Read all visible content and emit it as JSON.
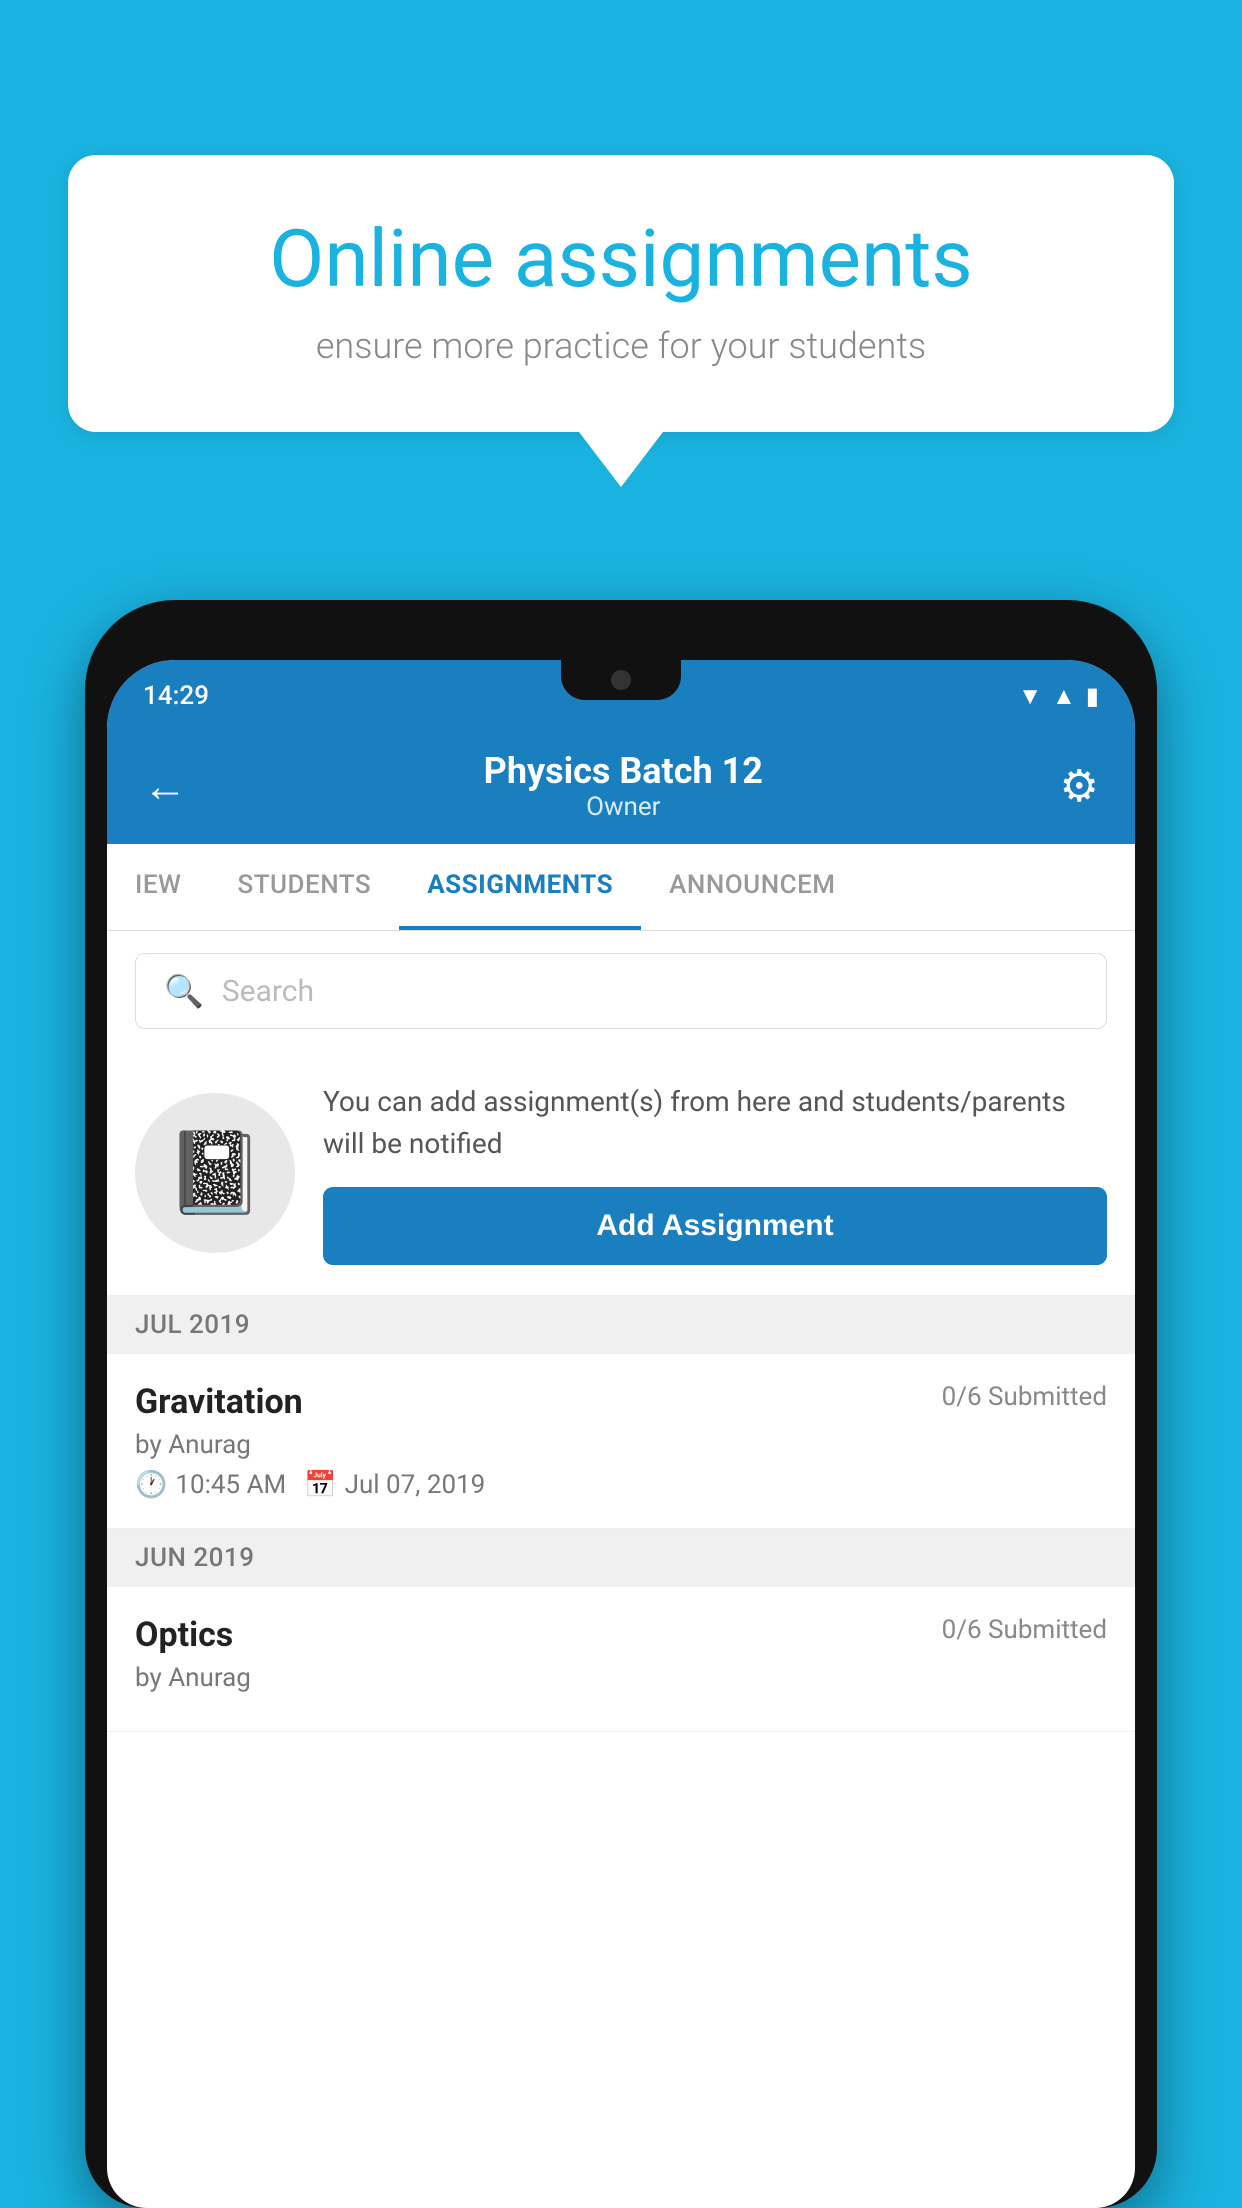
{
  "background": {
    "color": "#1ab3e0"
  },
  "speechBubble": {
    "title": "Online assignments",
    "subtitle": "ensure more practice for your students"
  },
  "phone": {
    "statusBar": {
      "time": "14:29"
    },
    "appHeader": {
      "title": "Physics Batch 12",
      "subtitle": "Owner"
    },
    "tabs": [
      {
        "label": "IEW",
        "active": false
      },
      {
        "label": "STUDENTS",
        "active": false
      },
      {
        "label": "ASSIGNMENTS",
        "active": true
      },
      {
        "label": "ANNOUNCEM",
        "active": false
      }
    ],
    "searchBar": {
      "placeholder": "Search"
    },
    "promoSection": {
      "description": "You can add assignment(s) from here and students/parents will be notified",
      "buttonLabel": "Add Assignment"
    },
    "sections": [
      {
        "label": "JUL 2019",
        "assignments": [
          {
            "title": "Gravitation",
            "submitted": "0/6 Submitted",
            "by": "by Anurag",
            "time": "10:45 AM",
            "date": "Jul 07, 2019"
          }
        ]
      },
      {
        "label": "JUN 2019",
        "assignments": [
          {
            "title": "Optics",
            "submitted": "0/6 Submitted",
            "by": "by Anurag",
            "time": "",
            "date": ""
          }
        ]
      }
    ]
  }
}
